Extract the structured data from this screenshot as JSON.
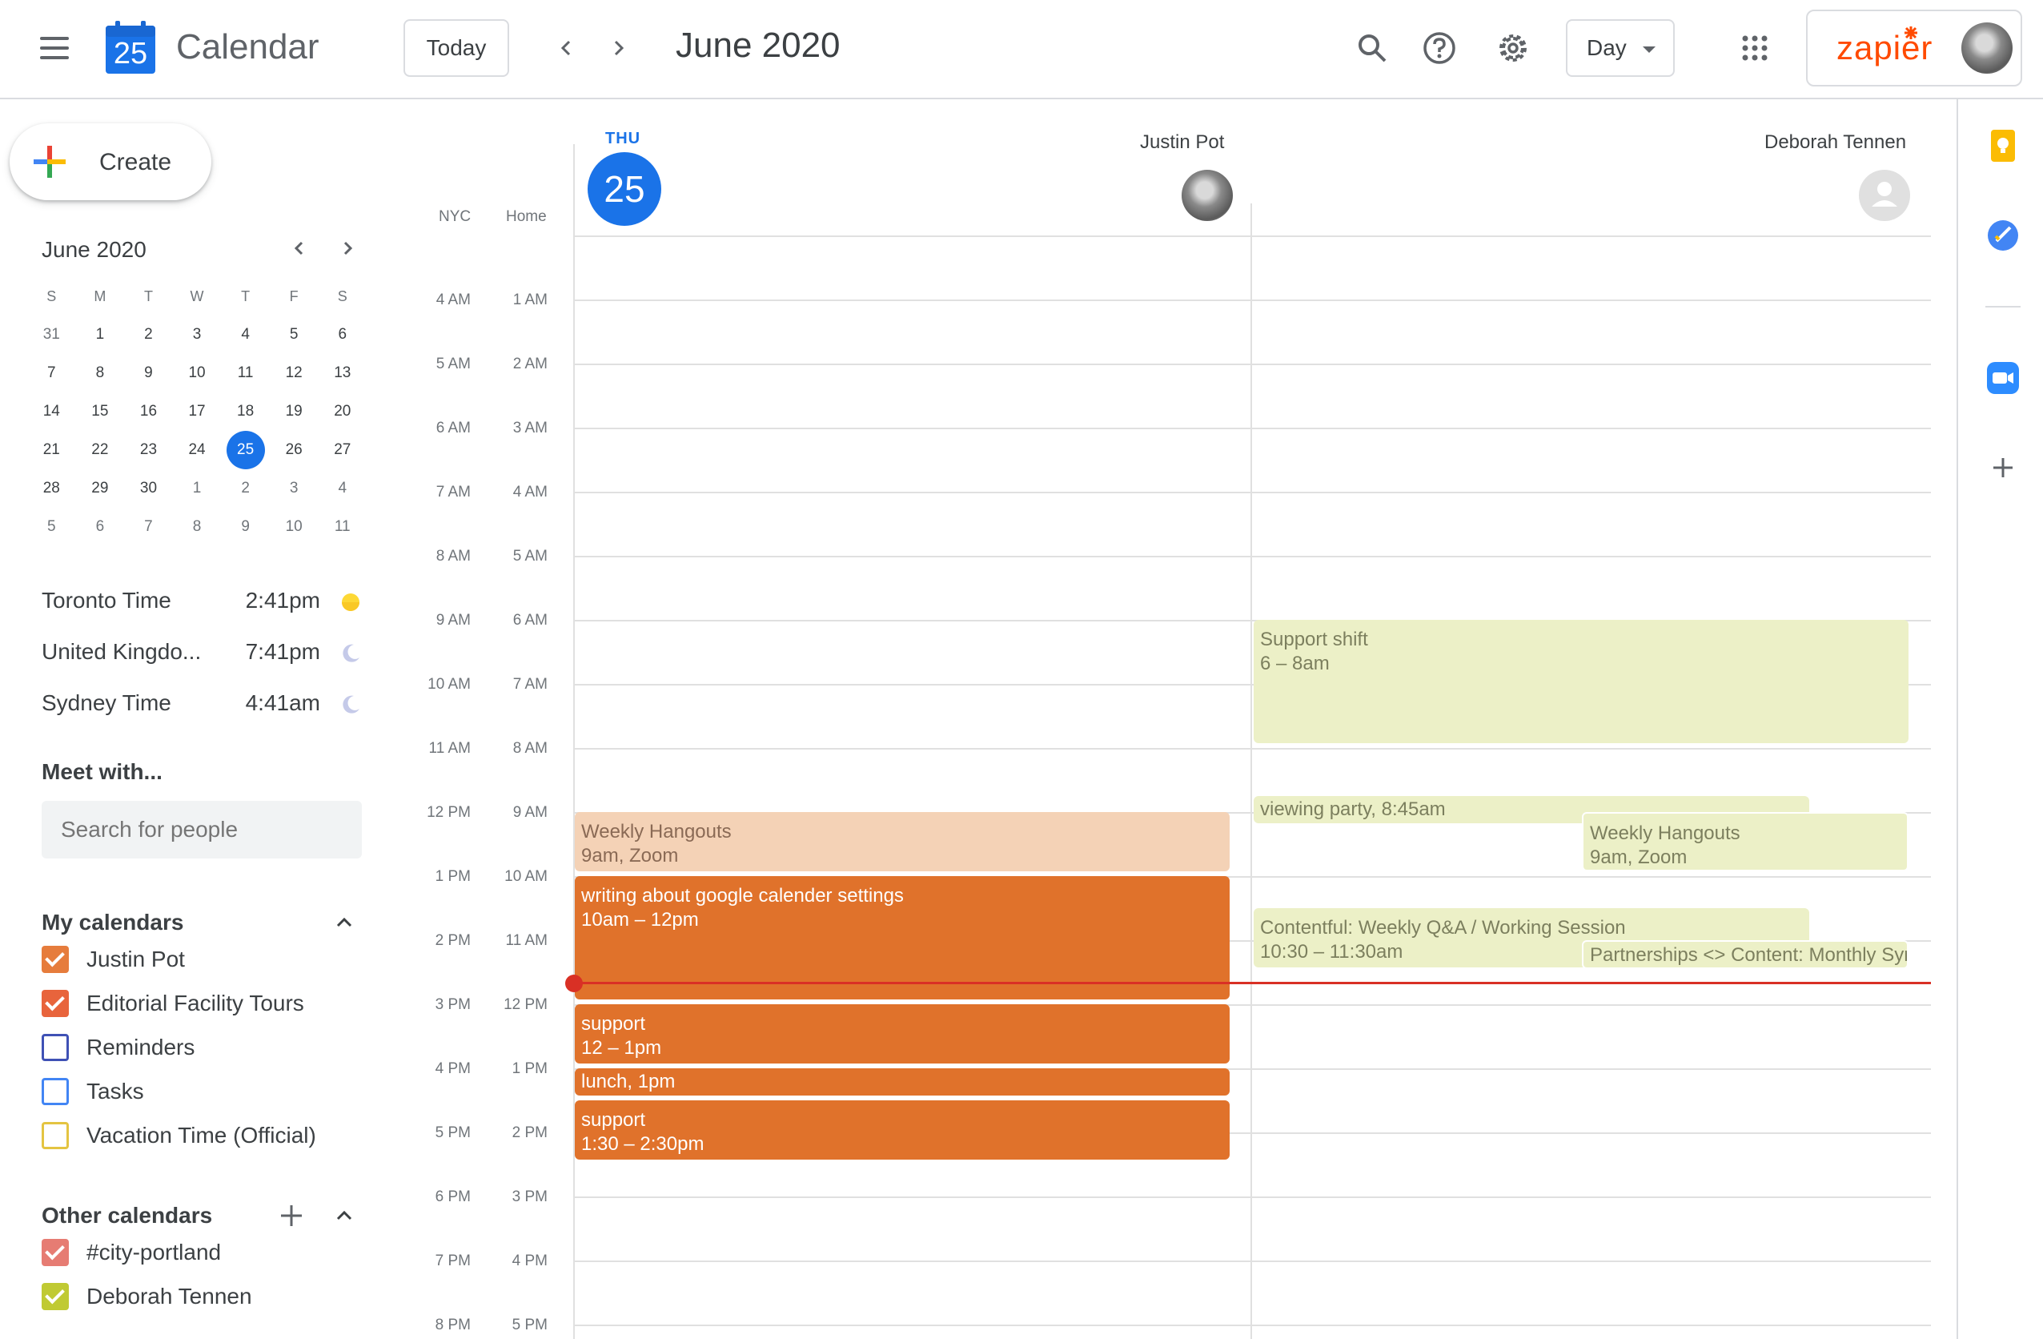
{
  "header": {
    "app_title": "Calendar",
    "logo_day": "25",
    "today_label": "Today",
    "date_title": "June 2020",
    "view_label": "Day",
    "account_brand": "zapier"
  },
  "sidebar": {
    "create_label": "Create",
    "mini_calendar": {
      "title": "June 2020",
      "weekdays": [
        "S",
        "M",
        "T",
        "W",
        "T",
        "F",
        "S"
      ],
      "weeks": [
        [
          "31",
          "1",
          "2",
          "3",
          "4",
          "5",
          "6"
        ],
        [
          "7",
          "8",
          "9",
          "10",
          "11",
          "12",
          "13"
        ],
        [
          "14",
          "15",
          "16",
          "17",
          "18",
          "19",
          "20"
        ],
        [
          "21",
          "22",
          "23",
          "24",
          "25",
          "26",
          "27"
        ],
        [
          "28",
          "29",
          "30",
          "1",
          "2",
          "3",
          "4"
        ],
        [
          "5",
          "6",
          "7",
          "8",
          "9",
          "10",
          "11"
        ]
      ],
      "selected": "25"
    },
    "world_clock": [
      {
        "label": "Toronto Time",
        "time": "2:41pm",
        "icon": "sun-icon"
      },
      {
        "label": "United Kingdo...",
        "time": "7:41pm",
        "icon": "moon-icon"
      },
      {
        "label": "Sydney Time",
        "time": "4:41am",
        "icon": "moon-icon"
      }
    ],
    "meet_with": {
      "title": "Meet with...",
      "placeholder": "Search for people"
    },
    "my_calendars": {
      "title": "My calendars",
      "items": [
        {
          "label": "Justin Pot",
          "color": "#e67c3c",
          "checked": true
        },
        {
          "label": "Editorial Facility Tours",
          "color": "#e8643c",
          "checked": true
        },
        {
          "label": "Reminders",
          "color": "#3f51b5",
          "checked": false
        },
        {
          "label": "Tasks",
          "color": "#4285f4",
          "checked": false
        },
        {
          "label": "Vacation Time (Official)",
          "color": "#e4c441",
          "checked": false
        }
      ]
    },
    "other_calendars": {
      "title": "Other calendars",
      "items": [
        {
          "label": "#city-portland",
          "color": "#e67c73",
          "checked": true
        },
        {
          "label": "Deborah Tennen",
          "color": "#c0ca33",
          "checked": true
        }
      ]
    }
  },
  "main": {
    "tz_labels": [
      "NYC",
      "Home"
    ],
    "day_name": "THU",
    "day_number": "25",
    "people": [
      "Justin Pot",
      "Deborah Tennen"
    ],
    "times_nyc": [
      "4 AM",
      "5 AM",
      "6 AM",
      "7 AM",
      "8 AM",
      "9 AM",
      "10 AM",
      "11 AM",
      "12 PM",
      "1 PM",
      "2 PM",
      "3 PM",
      "4 PM",
      "5 PM",
      "6 PM",
      "7 PM",
      "8 PM"
    ],
    "times_home": [
      "1 AM",
      "2 AM",
      "3 AM",
      "4 AM",
      "5 AM",
      "6 AM",
      "7 AM",
      "8 AM",
      "9 AM",
      "10 AM",
      "11 AM",
      "12 PM",
      "1 PM",
      "2 PM",
      "3 PM",
      "4 PM",
      "5 PM"
    ],
    "events_justin": [
      {
        "title": "Weekly Hangouts",
        "time": "9am, Zoom"
      },
      {
        "title": "writing about google calender settings",
        "time": "10am – 12pm"
      },
      {
        "title": "support",
        "time": "12 – 1pm"
      },
      {
        "title": "lunch",
        "time": ", 1pm"
      },
      {
        "title": "support",
        "time": "1:30 – 2:30pm"
      }
    ],
    "events_deborah": [
      {
        "title": "Support shift",
        "time": "6 – 8am"
      },
      {
        "title": "viewing party",
        "time": ", 8:45am"
      },
      {
        "title": "Weekly Hangouts",
        "time": "9am, Zoom"
      },
      {
        "title": "Contentful: Weekly Q&A / Working Session",
        "time": "10:30 – 11:30am"
      },
      {
        "title": "Partnerships <> Content: Monthly Sync"
      }
    ]
  }
}
